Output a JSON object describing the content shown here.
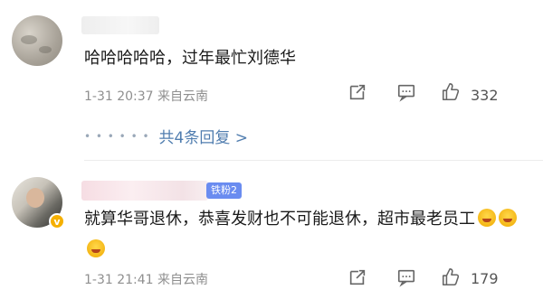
{
  "comments": [
    {
      "text": "哈哈哈哈哈，过年最忙刘德华",
      "time": "1-31 20:37",
      "location": "来自云南",
      "likes": "332",
      "replies_label": "共4条回复 >"
    },
    {
      "fan_badge": "铁粉2",
      "text": "就算华哥退休，恭喜发财也不可能退休，超市最老员工",
      "time": "1-31 21:41",
      "location": "来自云南",
      "likes": "179"
    }
  ],
  "icons": [
    "share-icon",
    "comment-icon",
    "like-icon"
  ]
}
